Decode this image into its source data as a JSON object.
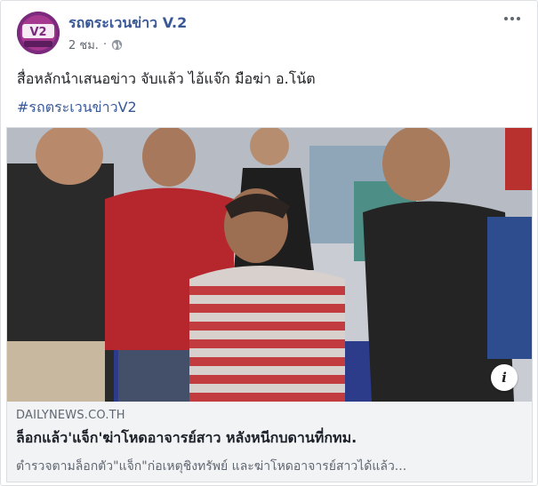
{
  "post": {
    "page_name": "รถตระเวนข่าว V.2",
    "avatar": {
      "logo_text": "V2",
      "sub_text": "รถตระเวนข่าว"
    },
    "timestamp": "2 ชม.",
    "privacy_icon": "globe-icon",
    "menu_icon": "more-options-icon",
    "text": "สื่อหลักนำเสนอข่าว จับแล้ว ไอ้แจ๊ก มือฆ่า อ.โน้ต",
    "hashtag": "#รถตระเวนข่าวV2"
  },
  "link_preview": {
    "photo_icon": "news-photo",
    "info_icon": "info-icon",
    "info_glyph": "i",
    "domain": "DAILYNEWS.CO.TH",
    "headline": "ล็อกแล้ว'แจ็ก'ฆ่าโหดอาจารย์สาว หลังหนีกบดานที่กทม.",
    "description": "ตำรวจตามล็อกตัว\"แจ็ก\"ก่อเหตุชิงทรัพย์ และฆ่าโหดอาจารย์สาวได้แล้ว..."
  },
  "colors": {
    "link_blue": "#385898",
    "secondary_text": "#606770",
    "card_background": "#f2f3f5",
    "avatar_purple": "#7b2a7e"
  }
}
